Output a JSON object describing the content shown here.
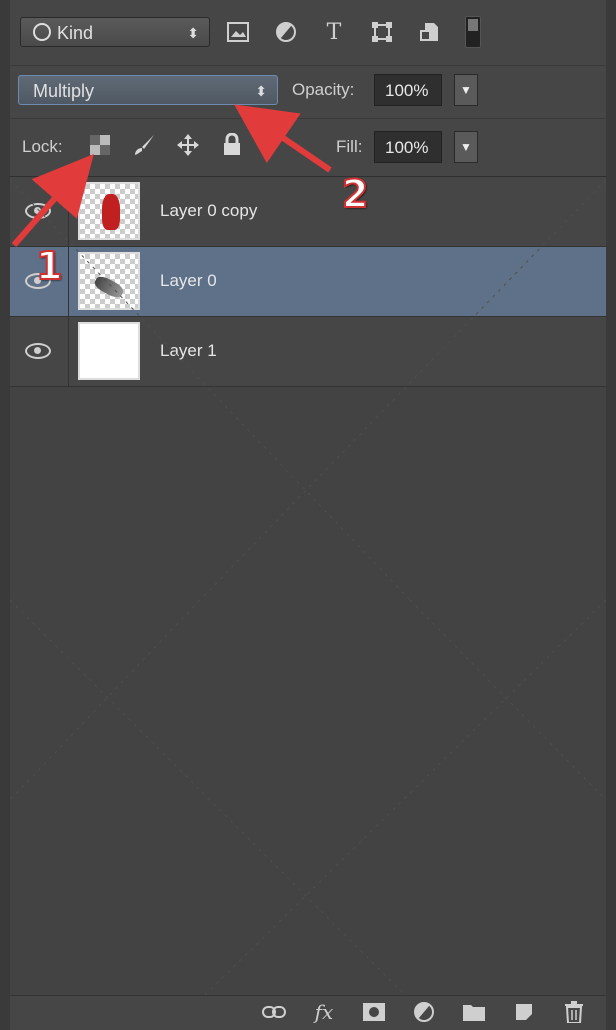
{
  "filter_bar": {
    "kind_label": "Kind",
    "kind_arrows": "⬍",
    "icons": [
      "image-filter-icon",
      "adjustment-filter-icon",
      "type-filter-icon",
      "shape-filter-icon",
      "smart-object-filter-icon",
      "filter-toggle-switch"
    ]
  },
  "blend_bar": {
    "mode": "Multiply",
    "mode_arrows": "⬍",
    "opacity_label": "Opacity:",
    "opacity_value": "100%"
  },
  "lock_bar": {
    "lock_label": "Lock:",
    "fill_label": "Fill:",
    "fill_value": "100%"
  },
  "layers": [
    {
      "name": "Layer 0 copy",
      "visible": true,
      "selected": false,
      "thumb": "red-figure"
    },
    {
      "name": "Layer 0",
      "visible": true,
      "selected": true,
      "thumb": "dark-smudge"
    },
    {
      "name": "Layer 1",
      "visible": true,
      "selected": false,
      "thumb": "white"
    }
  ],
  "annotations": {
    "one": "1",
    "two": "2",
    "arrow_color": "#e23b3b"
  },
  "bottom_toolbar": {
    "fx_label": "fx"
  }
}
